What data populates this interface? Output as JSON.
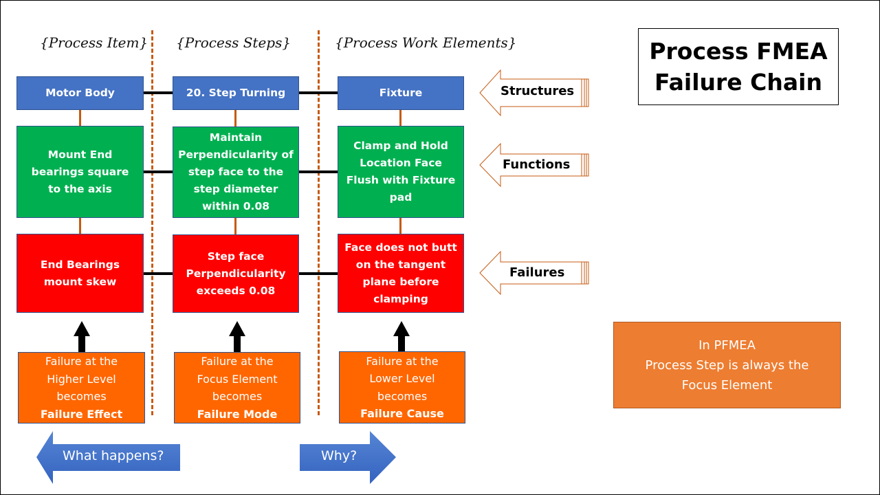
{
  "title": {
    "line1": "Process FMEA",
    "line2": "Failure Chain"
  },
  "columns": {
    "item": "{Process Item}",
    "steps": "{Process Steps}",
    "work_elements": "{Process Work Elements}"
  },
  "structures": {
    "item": "Motor Body",
    "step": "20. Step Turning",
    "work_element": "Fixture"
  },
  "functions": {
    "item": "Mount End bearings square to the axis",
    "step": "Maintain Perpendicularity of step face to the step diameter within 0.08",
    "work_element": "Clamp and Hold Location Face Flush with Fixture pad"
  },
  "failures": {
    "item": "End Bearings mount skew",
    "step": "Step face Perpendicularity exceeds 0.08",
    "work_element": "Face does not butt on the tangent plane before clamping"
  },
  "explanations": {
    "effect": {
      "line1": "Failure at the",
      "line2": "Higher Level",
      "line3": "becomes",
      "bold": "Failure Effect"
    },
    "mode": {
      "line1": "Failure at the",
      "line2": "Focus Element",
      "line3": "becomes",
      "bold": "Failure Mode"
    },
    "cause": {
      "line1": "Failure at the",
      "line2": "Lower Level",
      "line3": "becomes",
      "bold": "Failure Cause"
    }
  },
  "row_labels": {
    "structures": "Structures",
    "functions": "Functions",
    "failures": "Failures"
  },
  "directions": {
    "left": "What happens?",
    "right": "Why?"
  },
  "note": {
    "line1": "In PFMEA",
    "line2": "Process Step is always the",
    "line3": "Focus Element"
  },
  "colors": {
    "structure": "#4472c4",
    "function": "#00b050",
    "failure": "#ff0000",
    "explanation": "#ff6600",
    "note": "#ed7d31",
    "divider": "#c55a11"
  }
}
